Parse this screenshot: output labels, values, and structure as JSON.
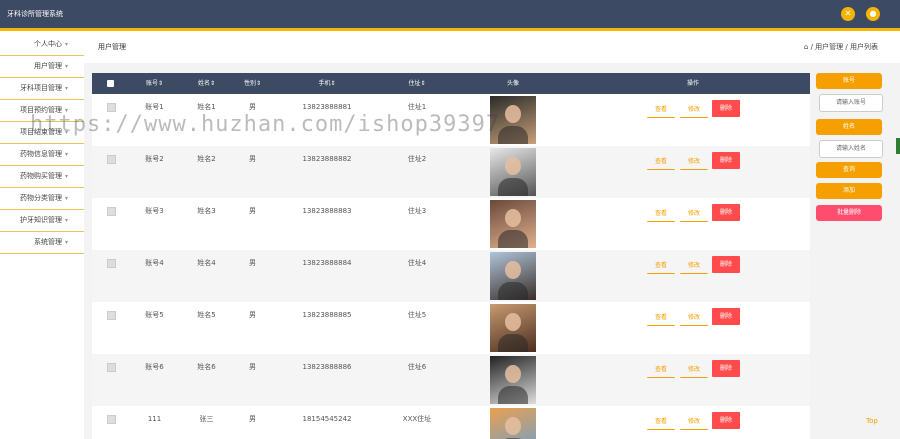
{
  "app_title": "牙科诊所管理系统",
  "sidebar": {
    "items": [
      {
        "label": "个人中心"
      },
      {
        "label": "用户管理"
      },
      {
        "label": "牙科项目管理"
      },
      {
        "label": "项目预约管理"
      },
      {
        "label": "项目结束管理"
      },
      {
        "label": "药物信息管理"
      },
      {
        "label": "药物购买管理"
      },
      {
        "label": "药物分类管理"
      },
      {
        "label": "护牙知识管理"
      },
      {
        "label": "系统管理"
      }
    ]
  },
  "page_title": "用户管理",
  "breadcrumb": "/ 用户管理 / 用户列表",
  "table": {
    "headers": [
      "账号⇕",
      "姓名⇕",
      "性别⇕",
      "手机⇕",
      "住址⇕",
      "头像",
      "操作"
    ],
    "rows": [
      {
        "account": "账号1",
        "name": "姓名1",
        "gender": "男",
        "phone": "13823888881",
        "address": "住址1"
      },
      {
        "account": "账号2",
        "name": "姓名2",
        "gender": "男",
        "phone": "13823888882",
        "address": "住址2"
      },
      {
        "account": "账号3",
        "name": "姓名3",
        "gender": "男",
        "phone": "13823888883",
        "address": "住址3"
      },
      {
        "account": "账号4",
        "name": "姓名4",
        "gender": "男",
        "phone": "13823888884",
        "address": "住址4"
      },
      {
        "account": "账号5",
        "name": "姓名5",
        "gender": "男",
        "phone": "13823888885",
        "address": "住址5"
      },
      {
        "account": "账号6",
        "name": "姓名6",
        "gender": "男",
        "phone": "13823888886",
        "address": "住址6"
      },
      {
        "account": "111",
        "name": "张三",
        "gender": "男",
        "phone": "18154545242",
        "address": "XXX住址"
      }
    ],
    "actions": {
      "view": "查看",
      "edit": "修改",
      "delete": "删除"
    }
  },
  "right_panel": {
    "account_label": "账号",
    "account_placeholder": "请输入账号",
    "name_label": "姓名",
    "name_placeholder": "请输入姓名",
    "search": "查询",
    "add": "添加",
    "batch_delete": "批量删除"
  },
  "watermark": "https://www.huzhan.com/ishop39397",
  "top_link": "Top",
  "colors": {
    "header": "#3d4a63",
    "accent": "#f5a000",
    "danger": "#ff4b4b",
    "pink": "#ff4d6d"
  }
}
